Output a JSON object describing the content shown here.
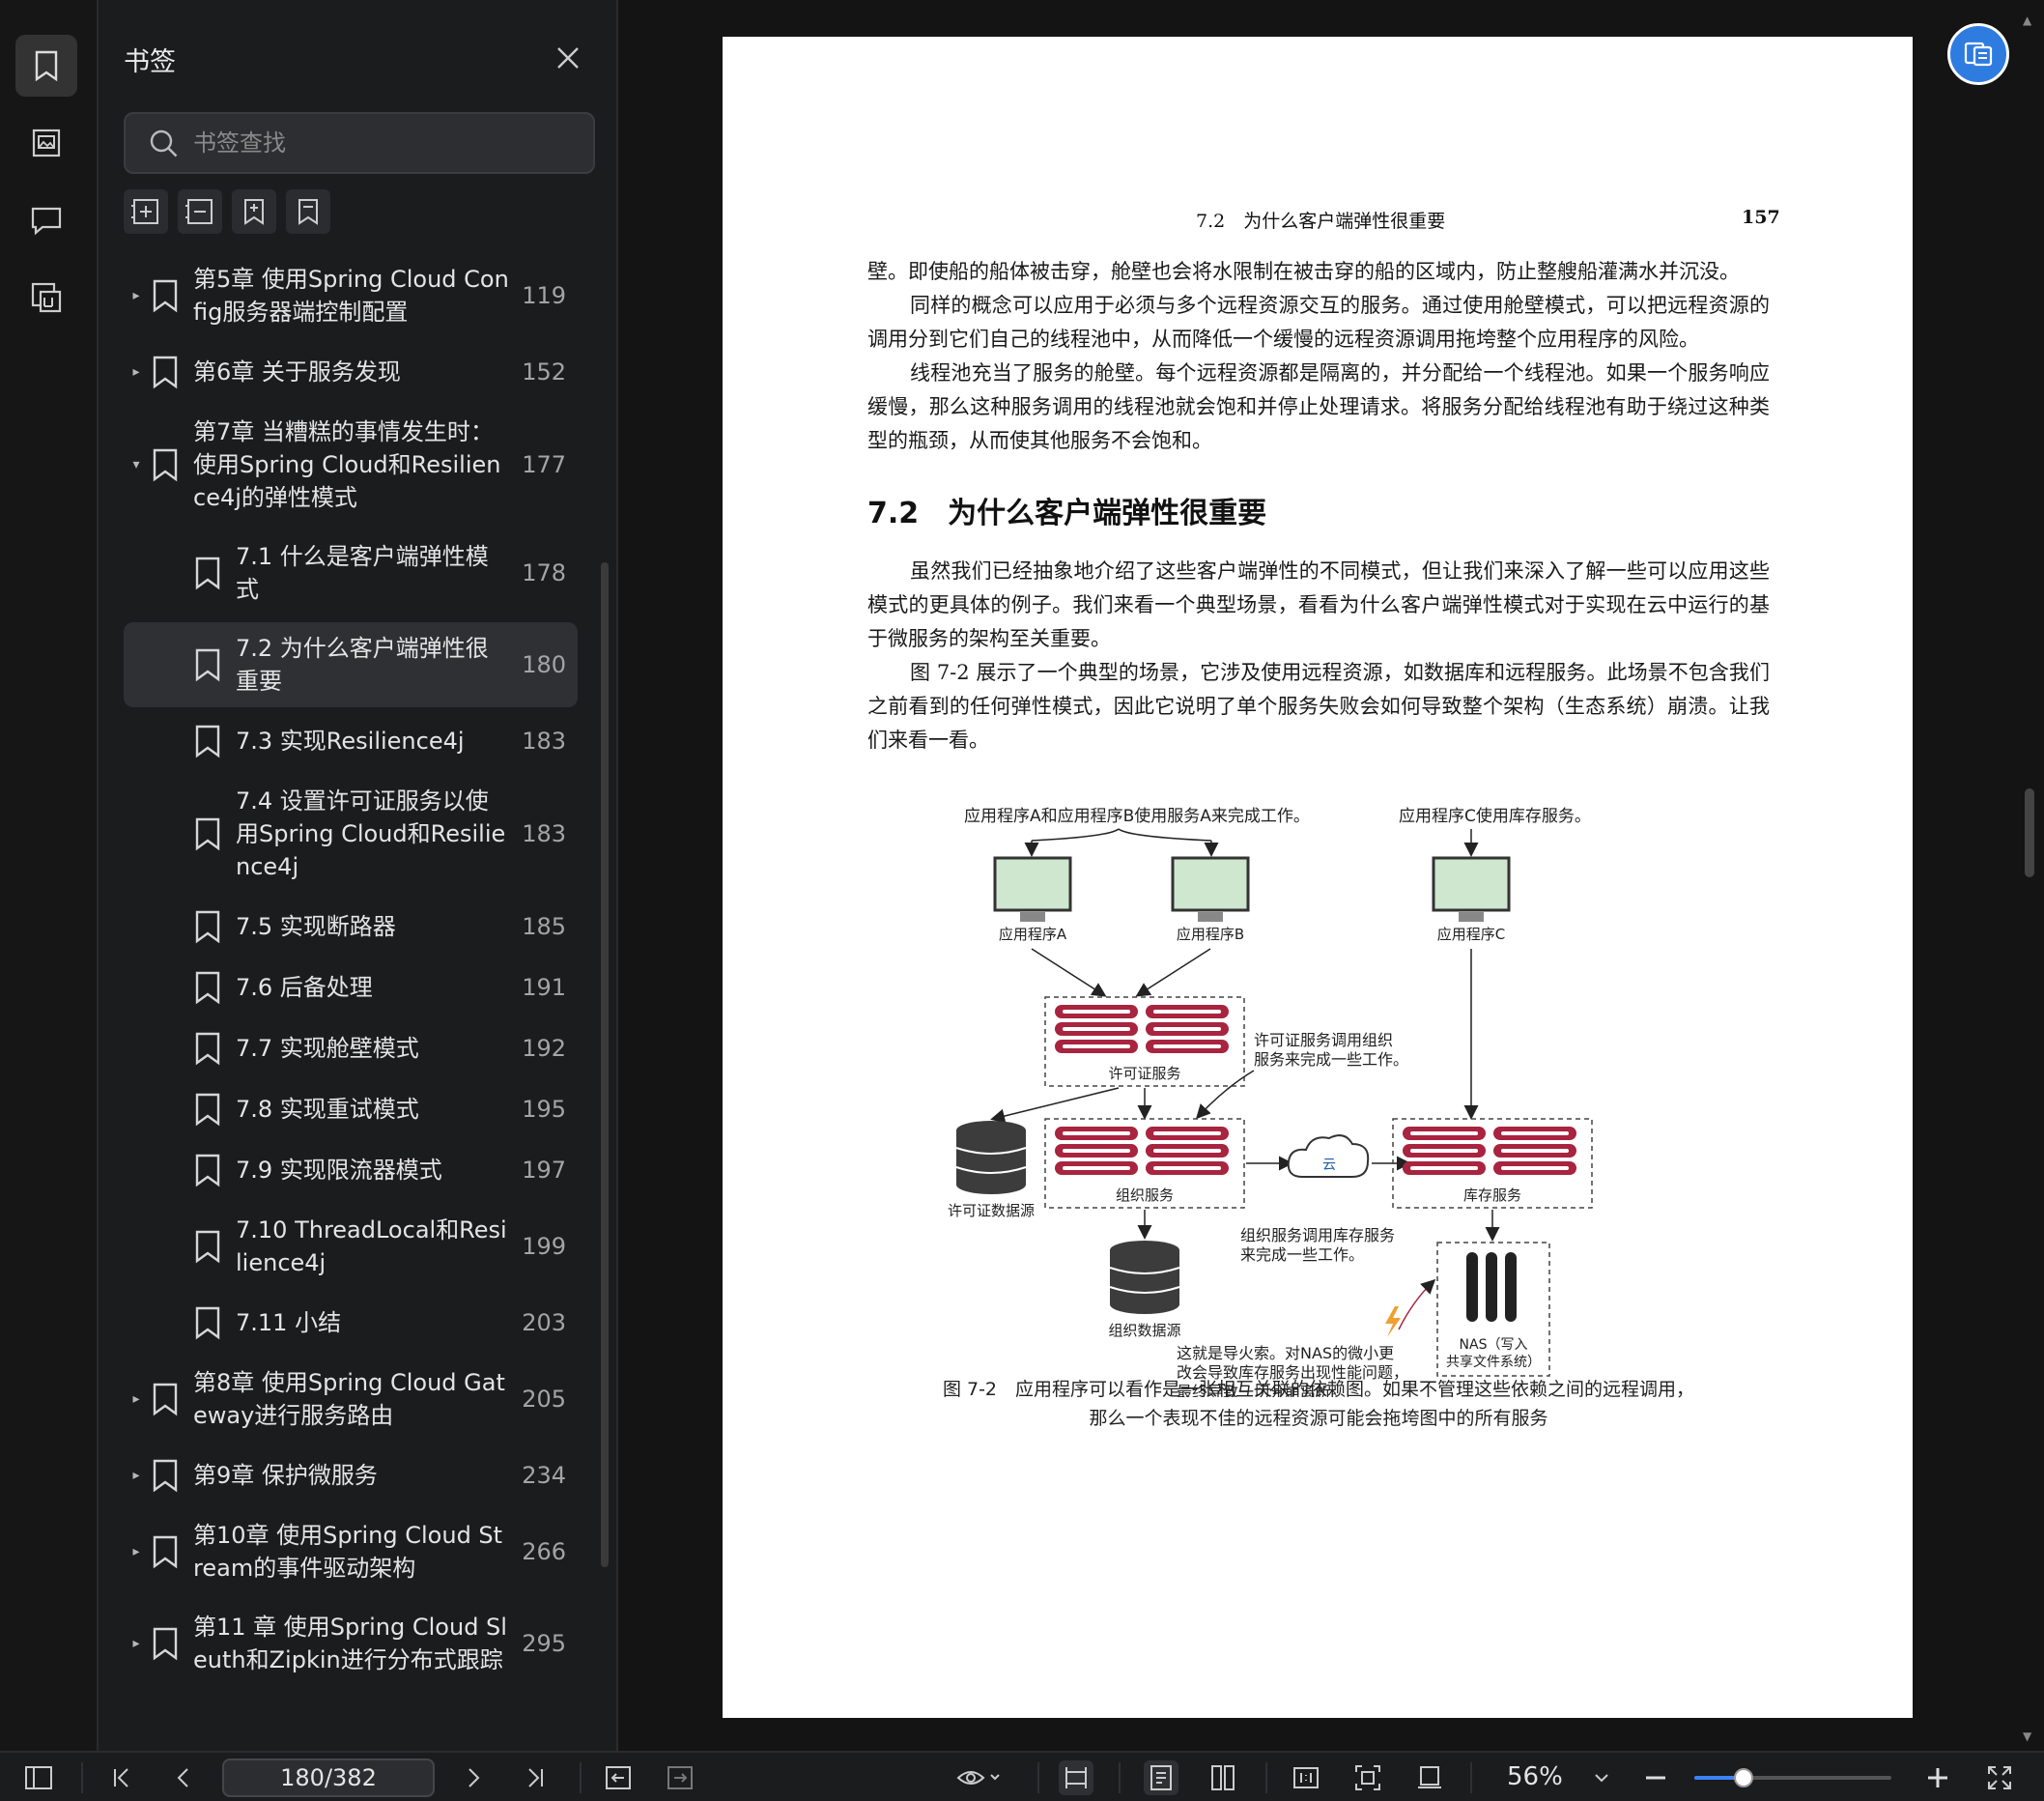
{
  "panel": {
    "title": "书签",
    "search_placeholder": "书签查找",
    "items": [
      {
        "label": "第5章 使用Spring Cloud Config服务器端控制配置",
        "page": "119",
        "expander": "▸",
        "level": 0
      },
      {
        "label": "第6章 关于服务发现",
        "page": "152",
        "expander": "▸",
        "level": 0
      },
      {
        "label": "第7章 当糟糕的事情发生时：使用Spring Cloud和Resilience4j的弹性模式",
        "page": "177",
        "expander": "▾",
        "level": 0
      },
      {
        "label": "7.1 什么是客户端弹性模式",
        "page": "178",
        "expander": "",
        "level": 1
      },
      {
        "label": "7.2 为什么客户端弹性很重要",
        "page": "180",
        "expander": "",
        "level": 1,
        "selected": true
      },
      {
        "label": "7.3 实现Resilience4j",
        "page": "183",
        "expander": "",
        "level": 1
      },
      {
        "label": "7.4 设置许可证服务以使用Spring Cloud和Resilience4j",
        "page": "183",
        "expander": "",
        "level": 1
      },
      {
        "label": "7.5 实现断路器",
        "page": "185",
        "expander": "",
        "level": 1
      },
      {
        "label": "7.6 后备处理",
        "page": "191",
        "expander": "",
        "level": 1
      },
      {
        "label": "7.7 实现舱壁模式",
        "page": "192",
        "expander": "",
        "level": 1
      },
      {
        "label": "7.8 实现重试模式",
        "page": "195",
        "expander": "",
        "level": 1
      },
      {
        "label": "7.9 实现限流器模式",
        "page": "197",
        "expander": "",
        "level": 1
      },
      {
        "label": "7.10 ThreadLocal和Resilience4j",
        "page": "199",
        "expander": "",
        "level": 1
      },
      {
        "label": "7.11 小结",
        "page": "203",
        "expander": "",
        "level": 1
      },
      {
        "label": "第8章 使用Spring Cloud Gateway进行服务路由",
        "page": "205",
        "expander": "▸",
        "level": 0
      },
      {
        "label": "第9章 保护微服务",
        "page": "234",
        "expander": "▸",
        "level": 0
      },
      {
        "label": "第10章 使用Spring Cloud Stream的事件驱动架构",
        "page": "266",
        "expander": "▸",
        "level": 0
      },
      {
        "label": "第11 章 使用Spring Cloud Sleuth和Zipkin进行分布式跟踪",
        "page": "295",
        "expander": "▸",
        "level": 0
      }
    ]
  },
  "document": {
    "running_title": "7.2　为什么客户端弹性很重要",
    "page_number": "157",
    "para1": "壁。即使船的船体被击穿，舱壁也会将水限制在被击穿的船的区域内，防止整艘船灌满水并沉没。",
    "para2": "同样的概念可以应用于必须与多个远程资源交互的服务。通过使用舱壁模式，可以把远程资源的调用分到它们自己的线程池中，从而降低一个缓慢的远程资源调用拖垮整个应用程序的风险。",
    "para3": "线程池充当了服务的舱壁。每个远程资源都是隔离的，并分配给一个线程池。如果一个服务响应缓慢，那么这种服务调用的线程池就会饱和并停止处理请求。将服务分配给线程池有助于绕过这种类型的瓶颈，从而使其他服务不会饱和。",
    "section_heading": "7.2　为什么客户端弹性很重要",
    "para4": "虽然我们已经抽象地介绍了这些客户端弹性的不同模式，但让我们来深入了解一些可以应用这些模式的更具体的例子。我们来看一个典型场景，看看为什么客户端弹性模式对于实现在云中运行的基于微服务的架构至关重要。",
    "para5": "图 7-2 展示了一个典型的场景，它涉及使用远程资源，如数据库和远程服务。此场景不包含我们之前看到的任何弹性模式，因此它说明了单个服务失败会如何导致整个架构（生态系统）崩溃。让我们来看一看。",
    "figure": {
      "note_ab": "应用程序A和应用程序B使用服务A来完成工作。",
      "note_c": "应用程序C使用库存服务。",
      "app_a": "应用程序A",
      "app_b": "应用程序B",
      "app_c": "应用程序C",
      "license_service": "许可证服务",
      "license_note_1": "许可证服务调用组织",
      "license_note_2": "服务来完成一些工作。",
      "license_db": "许可证数据源",
      "org_service": "组织服务",
      "cloud": "云",
      "inventory_service": "库存服务",
      "org_note_1": "组织服务调用库存服务",
      "org_note_2": "来完成一些工作。",
      "org_db": "组织数据源",
      "nas_1": "NAS（写入",
      "nas_2": "共享文件系统）",
      "fuse_1": "这就是导火索。对NAS的微小更",
      "fuse_2": "改会导致库存服务出现性能问题，",
      "fuse_3": "最终导致一切分崩离析。"
    },
    "caption_1": "图 7-2　应用程序可以看作是一张相互关联的依赖图。如果不管理这些依赖之间的远程调用，",
    "caption_2": "那么一个表现不佳的远程资源可能会拖垮图中的所有服务"
  },
  "toolbar": {
    "page_indicator": "180/382",
    "zoom": "56%",
    "zoom_fraction": 0.25
  },
  "colors": {
    "accent": "#3b82f6",
    "server_red": "#a8243f",
    "monitor_green": "#cfe6cf",
    "fab": "#2f7ce0"
  }
}
